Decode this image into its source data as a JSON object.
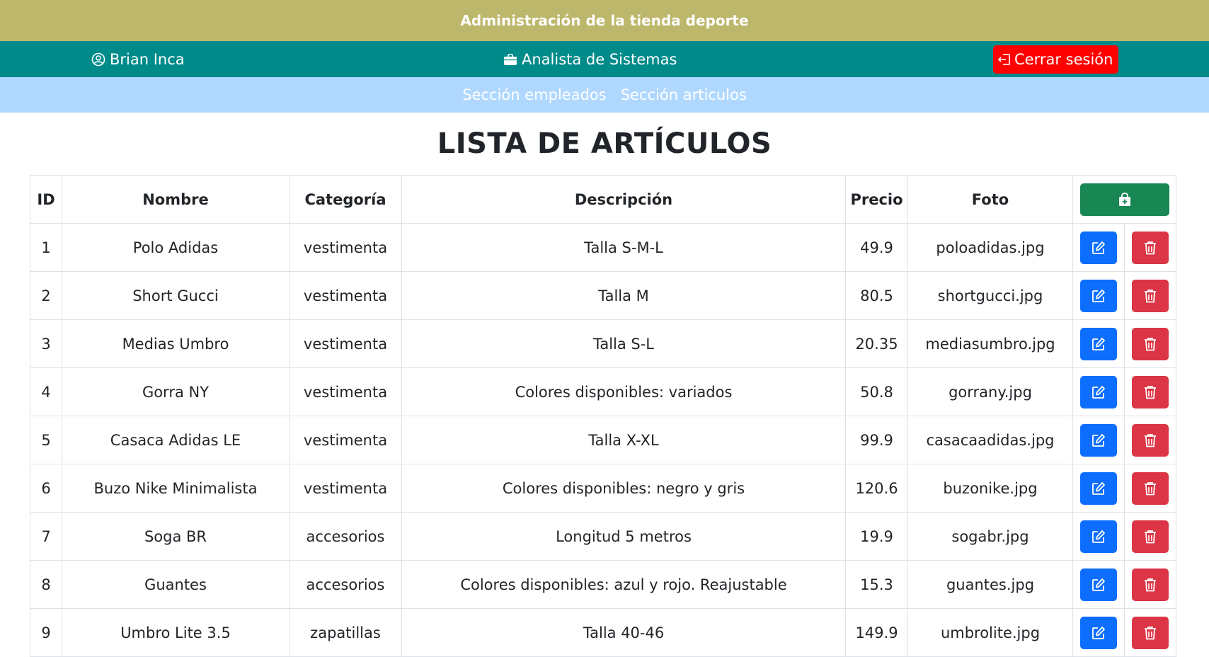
{
  "header": {
    "title": "Administración de la tienda deporte"
  },
  "userbar": {
    "user_name": "Brian Inca",
    "role": "Analista de Sistemas",
    "logout_label": "Cerrar sesión"
  },
  "nav": {
    "items": [
      "Sección empleados",
      "Sección articulos"
    ]
  },
  "page": {
    "title": "LISTA DE ARTÍCULOS"
  },
  "table": {
    "columns": [
      "ID",
      "Nombre",
      "Categoría",
      "Descripción",
      "Precio",
      "Foto"
    ],
    "rows": [
      [
        "1",
        "Polo Adidas",
        "vestimenta",
        "Talla S-M-L",
        "49.9",
        "poloadidas.jpg"
      ],
      [
        "2",
        "Short Gucci",
        "vestimenta",
        "Talla M",
        "80.5",
        "shortgucci.jpg"
      ],
      [
        "3",
        "Medias Umbro",
        "vestimenta",
        "Talla S-L",
        "20.35",
        "mediasumbro.jpg"
      ],
      [
        "4",
        "Gorra NY",
        "vestimenta",
        "Colores disponibles: variados",
        "50.8",
        "gorrany.jpg"
      ],
      [
        "5",
        "Casaca Adidas LE",
        "vestimenta",
        "Talla X-XL",
        "99.9",
        "casacaadidas.jpg"
      ],
      [
        "6",
        "Buzo Nike Minimalista",
        "vestimenta",
        "Colores disponibles: negro y gris",
        "120.6",
        "buzonike.jpg"
      ],
      [
        "7",
        "Soga BR",
        "accesorios",
        "Longitud 5 metros",
        "19.9",
        "sogabr.jpg"
      ],
      [
        "8",
        "Guantes",
        "accesorios",
        "Colores disponibles: azul y rojo. Reajustable",
        "15.3",
        "guantes.jpg"
      ],
      [
        "9",
        "Umbro Lite 3.5",
        "zapatillas",
        "Talla 40-46",
        "149.9",
        "umbrolite.jpg"
      ]
    ]
  },
  "icons": {
    "user": "user-circle-icon",
    "role": "briefcase-icon",
    "logout": "logout-icon",
    "add": "shopping-bag-plus-icon",
    "edit": "edit-icon",
    "delete": "trash-icon"
  },
  "colors": {
    "topbar": "#bdb76b",
    "userbar": "#008b8b",
    "navbar": "#b0d8ff",
    "logout": "#ff0000",
    "add": "#198754",
    "edit": "#0d6efd",
    "delete": "#dc3545"
  }
}
